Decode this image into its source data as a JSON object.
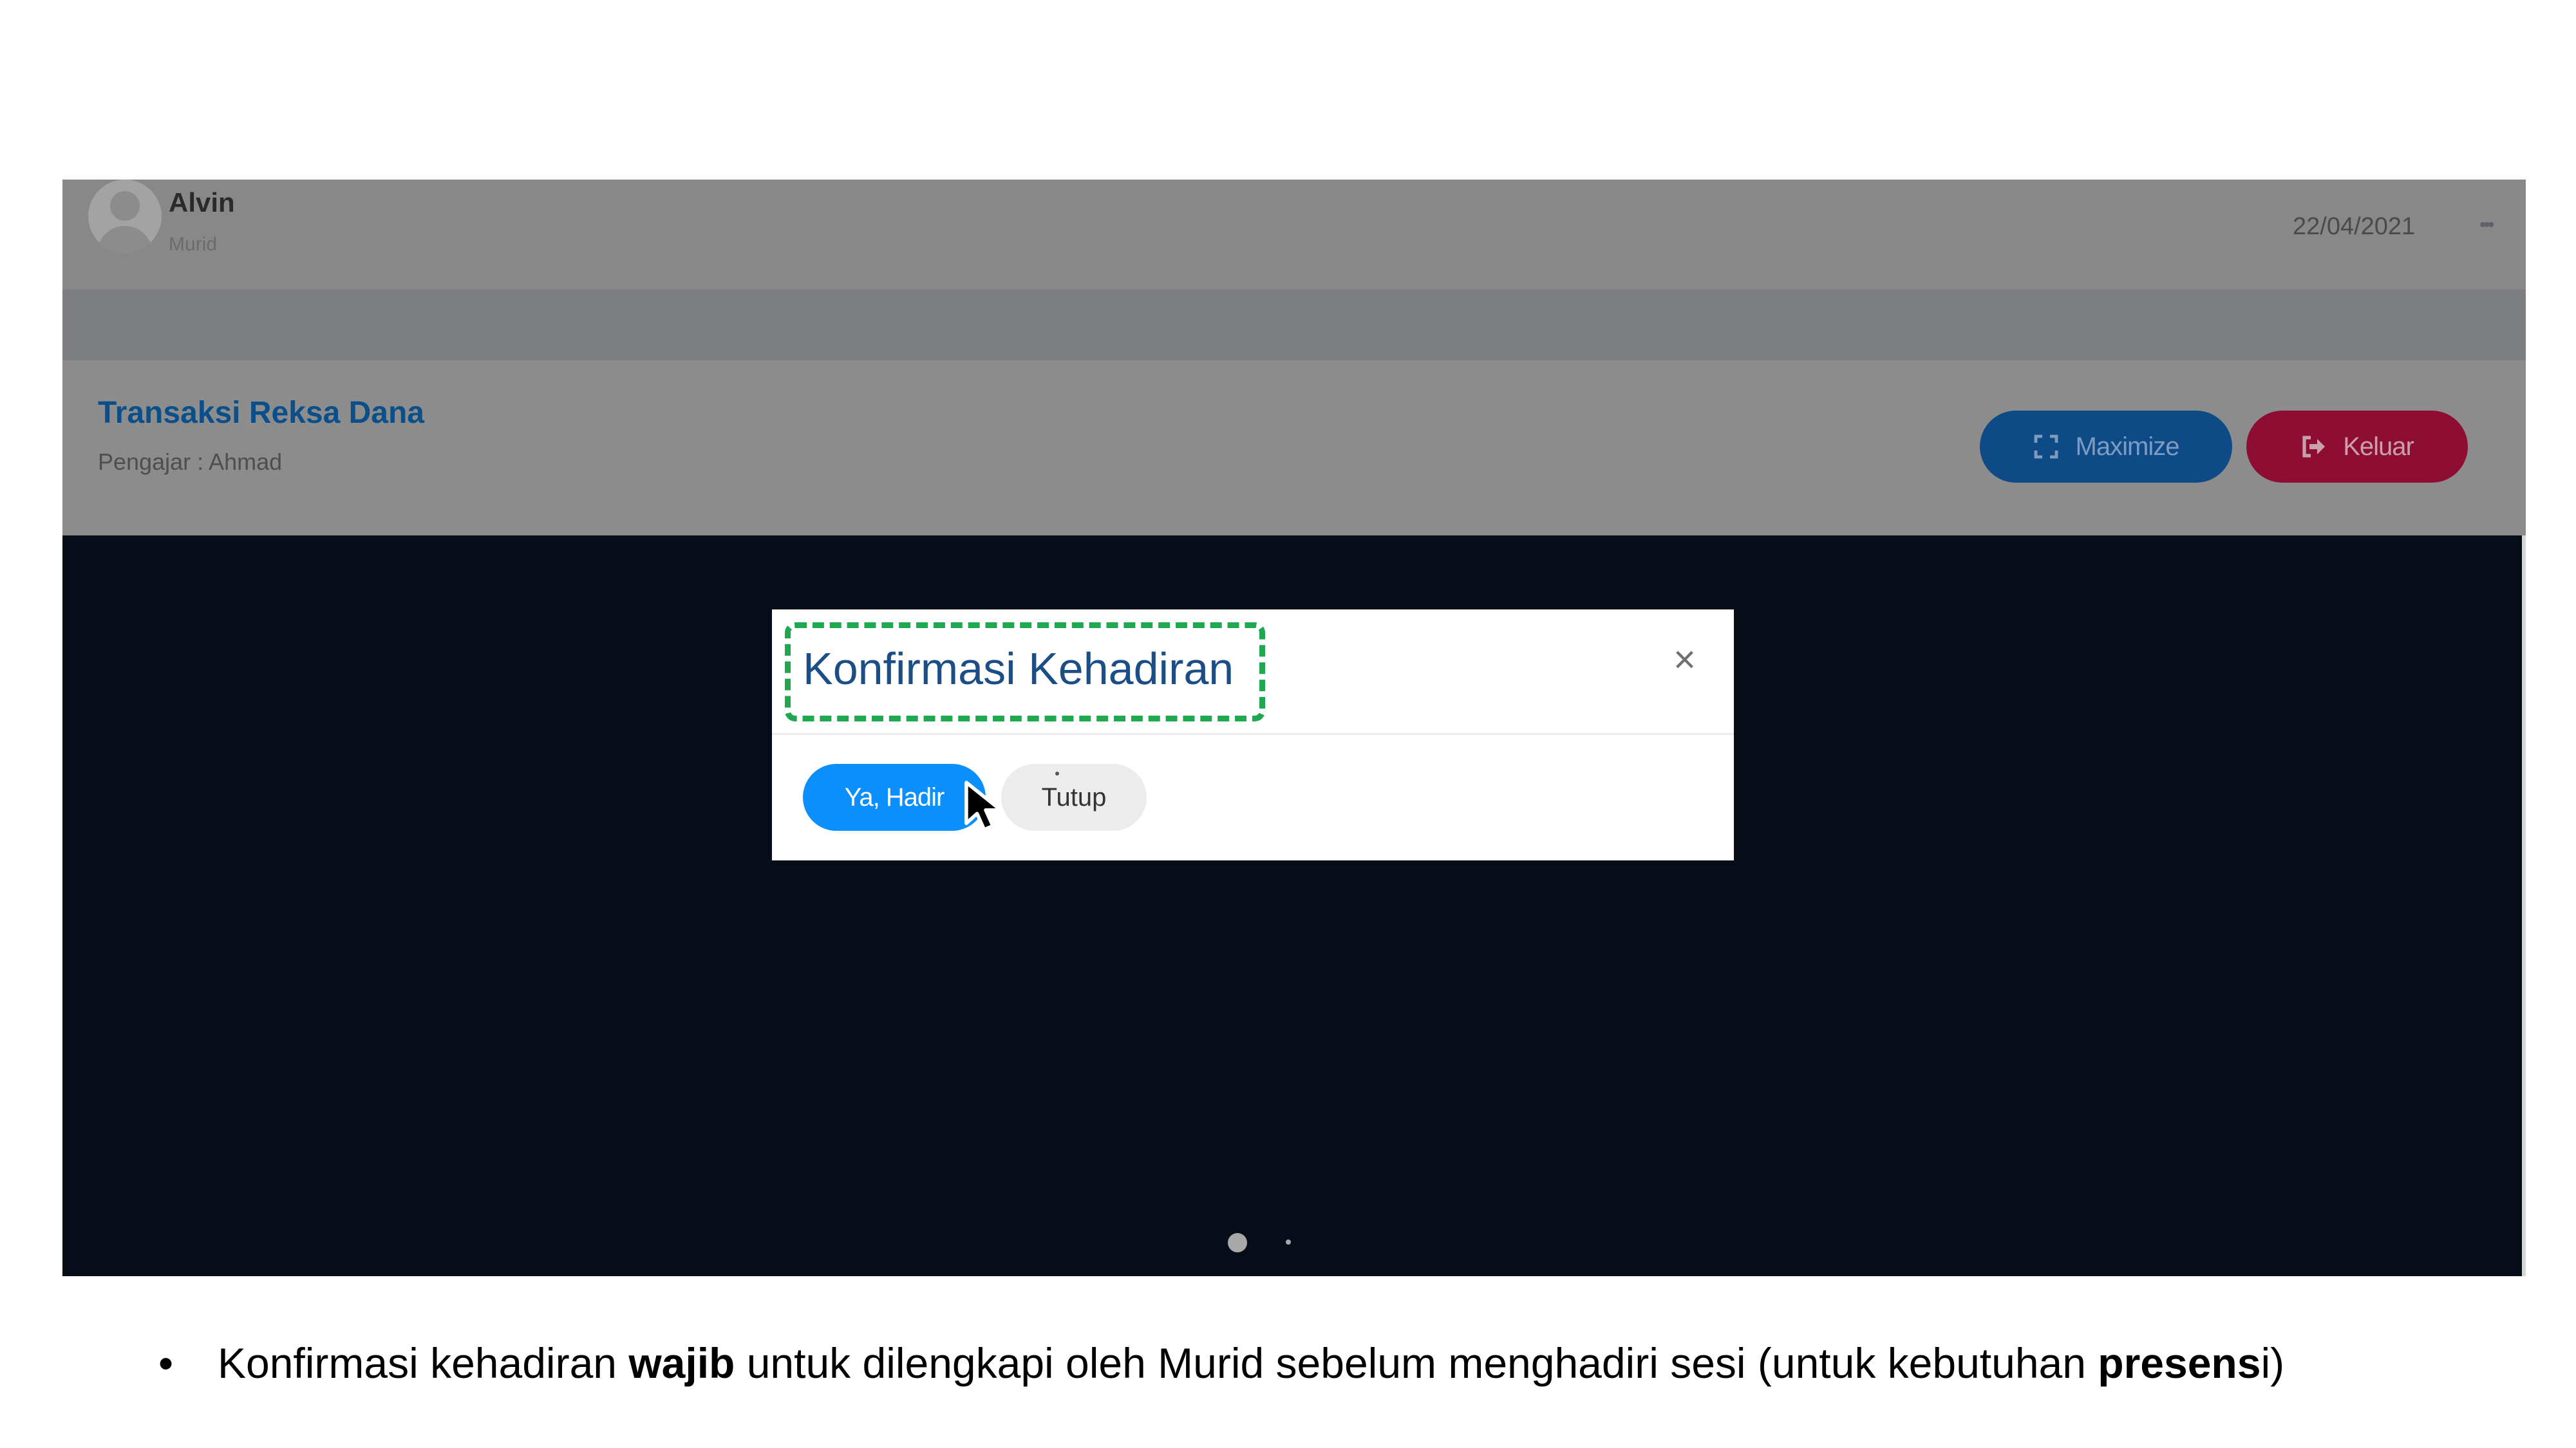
{
  "header": {
    "user_name": "Alvin",
    "user_role": "Murid",
    "date": "22/04/2021",
    "more": "•••"
  },
  "class_info": {
    "title": "Transaksi Reksa Dana",
    "teacher_label": "Pengajar : Ahmad"
  },
  "toolbar": {
    "maximize_label": "Maximize",
    "exit_label": "Keluar"
  },
  "modal": {
    "title": "Konfirmasi Kehadiran",
    "close_glyph": "×",
    "confirm_label": "Ya, Hadir",
    "cancel_label": "Tutup"
  },
  "caption": {
    "bullet": "•",
    "part1": "Konfirmasi kehadiran ",
    "bold1": "wajib",
    "part2": " untuk dilengkapi oleh Murid sebelum menghadiri sesi (untuk kebutuhan ",
    "bold2": "presens",
    "part3": "i)"
  },
  "colors": {
    "highlight": "#1fa84f",
    "primary": "#0b8ffc",
    "danger": "#8e0d33",
    "title": "#1b4e87"
  },
  "icons": {
    "maximize": "expand-icon",
    "exit": "sign-out-icon",
    "close": "close-icon",
    "cursor": "mouse-pointer-icon",
    "avatar": "user-avatar-icon"
  }
}
